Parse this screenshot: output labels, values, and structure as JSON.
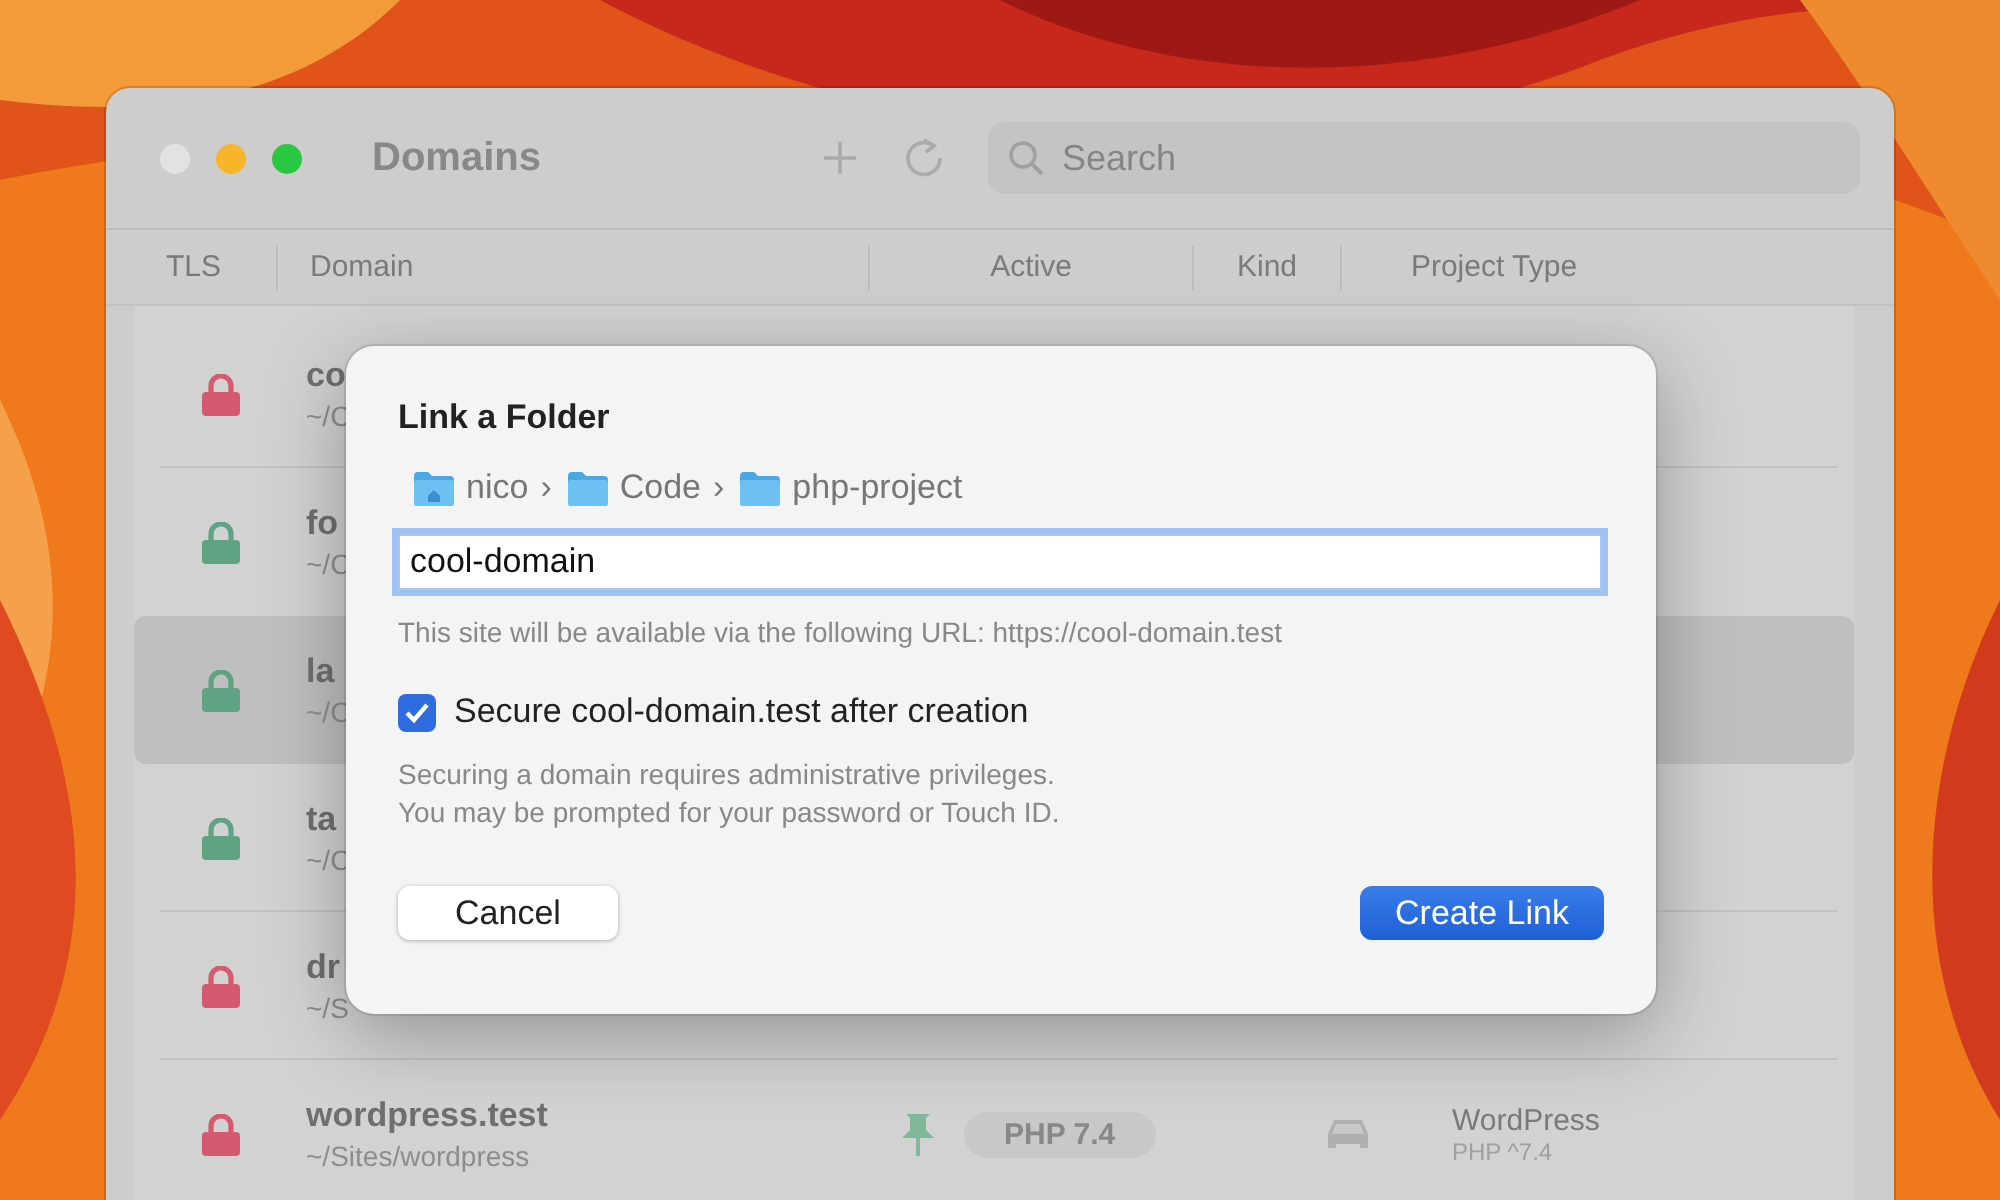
{
  "window": {
    "title": "Domains",
    "search": {
      "placeholder": "Search"
    }
  },
  "table": {
    "columns": [
      "TLS",
      "Domain",
      "Active",
      "Kind",
      "Project Type"
    ],
    "rows": [
      {
        "secured": false,
        "domain": "co",
        "path": "~/C",
        "selected": false
      },
      {
        "secured": true,
        "domain": "fo",
        "path": "~/C",
        "selected": false
      },
      {
        "secured": true,
        "domain": "la",
        "path": "~/C",
        "selected": true
      },
      {
        "secured": true,
        "domain": "ta",
        "path": "~/C",
        "selected": false
      },
      {
        "secured": false,
        "domain": "dr",
        "path": "~/S",
        "selected": false
      },
      {
        "secured": false,
        "domain": "wordpress.test",
        "path": "~/Sites/wordpress",
        "selected": false,
        "active": "PHP 7.4",
        "project_type": "WordPress",
        "project_version": "PHP ^7.4"
      }
    ]
  },
  "dialog": {
    "title": "Link a Folder",
    "breadcrumb": [
      {
        "label": "nico",
        "kind": "home",
        "separator": "›"
      },
      {
        "label": "Code",
        "kind": "folder",
        "separator": "›"
      },
      {
        "label": "php-project",
        "kind": "folder"
      }
    ],
    "field": {
      "value": "cool-domain"
    },
    "hint": "This site will be available via the following URL: https://cool-domain.test",
    "checkbox": {
      "label": "Secure cool-domain.test after creation",
      "checked": true
    },
    "note_lines": [
      "Securing a domain requires administrative privileges.",
      "You may be prompted for your password or Touch ID."
    ],
    "buttons": [
      {
        "label": "Cancel",
        "kind": "secondary"
      },
      {
        "label": "Create Link",
        "kind": "primary"
      }
    ]
  }
}
